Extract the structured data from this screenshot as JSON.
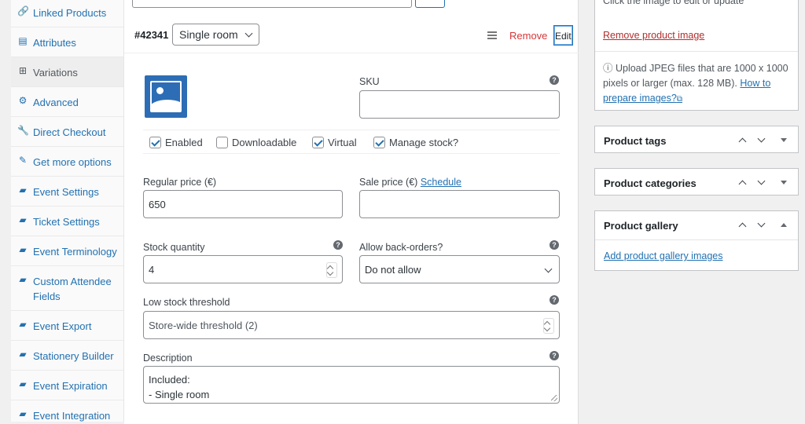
{
  "tabs": [
    {
      "icon": "link-icon",
      "glyph": "🔗",
      "label": "Linked Products",
      "active": false
    },
    {
      "icon": "list-icon",
      "glyph": "▤",
      "label": "Attributes",
      "active": false
    },
    {
      "icon": "grid-icon",
      "glyph": "⊞",
      "label": "Variations",
      "active": true
    },
    {
      "icon": "gear-icon",
      "glyph": "⚙",
      "label": "Advanced",
      "active": false
    },
    {
      "icon": "wrench-icon",
      "glyph": "🔧",
      "label": "Direct Checkout",
      "active": false
    },
    {
      "icon": "plugin-icon",
      "glyph": "✎",
      "label": "Get more options",
      "active": false
    },
    {
      "icon": "ticket-icon",
      "glyph": "▰",
      "label": "Event Settings",
      "active": false
    },
    {
      "icon": "ticket-icon",
      "glyph": "▰",
      "label": "Ticket Settings",
      "active": false
    },
    {
      "icon": "ticket-icon",
      "glyph": "▰",
      "label": "Event Terminology",
      "active": false
    },
    {
      "icon": "ticket-icon",
      "glyph": "▰",
      "label": "Custom Attendee Fields",
      "active": false
    },
    {
      "icon": "ticket-icon",
      "glyph": "▰",
      "label": "Event Export",
      "active": false
    },
    {
      "icon": "ticket-icon",
      "glyph": "▰",
      "label": "Stationery Builder",
      "active": false
    },
    {
      "icon": "ticket-icon",
      "glyph": "▰",
      "label": "Event Expiration",
      "active": false
    },
    {
      "icon": "ticket-icon",
      "glyph": "▰",
      "label": "Event Integration",
      "active": false
    }
  ],
  "variation": {
    "id": "#42341",
    "attribute_value": "Single room",
    "remove_label": "Remove",
    "edit_label": "Edit",
    "sku_label": "SKU",
    "sku_value": "",
    "checkboxes": [
      {
        "label": "Enabled",
        "checked": true
      },
      {
        "label": "Downloadable",
        "checked": false
      },
      {
        "label": "Virtual",
        "checked": true
      },
      {
        "label": "Manage stock?",
        "checked": true
      }
    ],
    "regular_price_label": "Regular price (€)",
    "regular_price": "650",
    "sale_price_label": "Sale price (€)",
    "schedule_label": "Schedule",
    "sale_price": "",
    "stock_qty_label": "Stock quantity",
    "stock_qty": "4",
    "backorders_label": "Allow back-orders?",
    "backorders_value": "Do not allow",
    "low_stock_label": "Low stock threshold",
    "low_stock_placeholder": "Store-wide threshold (2)",
    "description_label": "Description",
    "description_lines": [
      "Included:",
      "- Single room"
    ],
    "help_glyph": "?"
  },
  "sidebar": {
    "image_hint": "Click the image to edit or update",
    "remove_image": "Remove product image",
    "upload_note": "ⓘ Upload JPEG files that are 1000 x 1000 pixels or larger (max. 128 MB).",
    "upload_link": "How to prepare images?",
    "external_glyph": "⧉",
    "tags_title": "Product tags",
    "categories_title": "Product categories",
    "gallery_title": "Product gallery",
    "gallery_link": "Add product gallery images"
  }
}
